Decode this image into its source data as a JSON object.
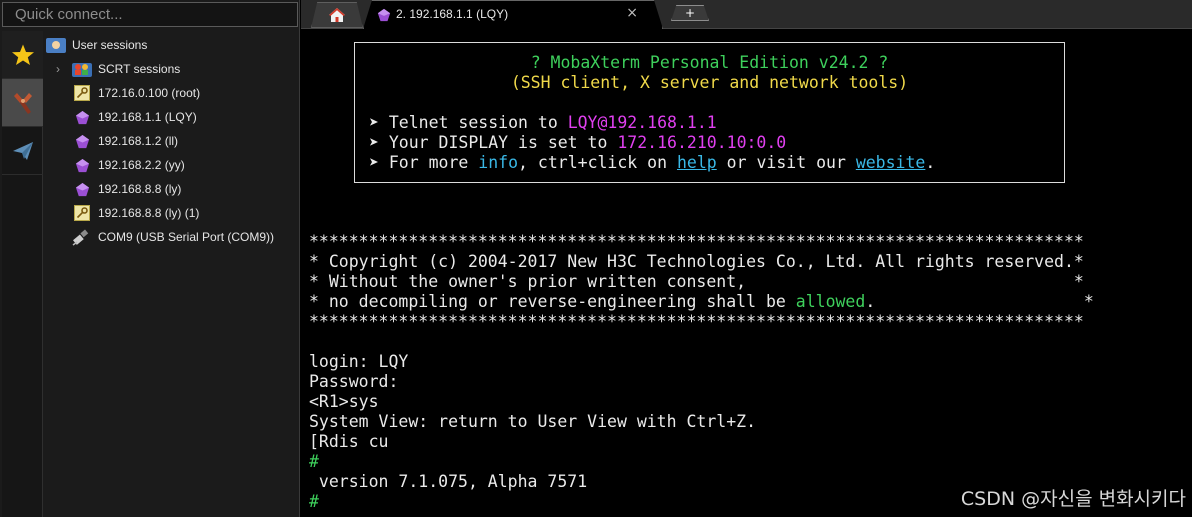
{
  "quick_connect": {
    "placeholder": "Quick connect..."
  },
  "sidebar": {
    "vtabs": [
      "star-icon",
      "tools-icon",
      "send-icon"
    ],
    "root": "User sessions",
    "folder": "SCRT sessions",
    "sessions": [
      {
        "label": "172.16.0.100 (root)",
        "icon": "key-icon"
      },
      {
        "label": "192.168.1.1 (LQY)",
        "icon": "gem-icon"
      },
      {
        "label": "192.168.1.2 (ll)",
        "icon": "gem-icon"
      },
      {
        "label": "192.168.2.2 (yy)",
        "icon": "gem-icon"
      },
      {
        "label": "192.168.8.8 (ly)",
        "icon": "gem-icon"
      },
      {
        "label": "192.168.8.8 (ly) (1)",
        "icon": "key-icon"
      },
      {
        "label": "COM9  (USB Serial Port (COM9))",
        "icon": "serial-icon"
      }
    ]
  },
  "tabs": {
    "active_label": "2. 192.168.1.1 (LQY)",
    "close_glyph": "×",
    "new_glyph": "+"
  },
  "banner": {
    "title": "? MobaXterm Personal Edition v24.2 ?",
    "subtitle": "(SSH client, X server and network tools)",
    "bullet": "➤",
    "l1_pre": "Telnet session to ",
    "l1_val": "LQY@192.168.1.1",
    "l2_pre": "Your DISPLAY is set to ",
    "l2_val": "172.16.210.10:0.0",
    "l3_pre": "For more ",
    "l3_info": "info",
    "l3_mid": ", ctrl+click on ",
    "l3_help": "help",
    "l3_mid2": " or visit our ",
    "l3_web": "website",
    "l3_end": "."
  },
  "terminal": {
    "stars": "******************************************************************************",
    "copy1": "* Copyright (c) 2004-2017 New H3C Technologies Co., Ltd. All rights reserved.*",
    "copy2": "* Without the owner's prior written consent,                                 *",
    "copy3_pre": "* no decompiling or reverse-engineering shall be ",
    "copy3_word": "allowed",
    "copy3_post": ".                     *",
    "login": "login: LQY",
    "password": "Password:",
    "prompt": "<R1>sys",
    "sysview": "System View: return to User View with Ctrl+Z.",
    "cmd": "[Rdis cu",
    "hash1": "#",
    "version": " version 7.1.075, Alpha 7571",
    "hash2": "#"
  },
  "watermark": "CSDN @자신을 변화시키다",
  "colors": {
    "green": "#3ed05c",
    "yellow": "#f0d94a",
    "magenta": "#e040f0",
    "cyan": "#3ab8e6"
  }
}
